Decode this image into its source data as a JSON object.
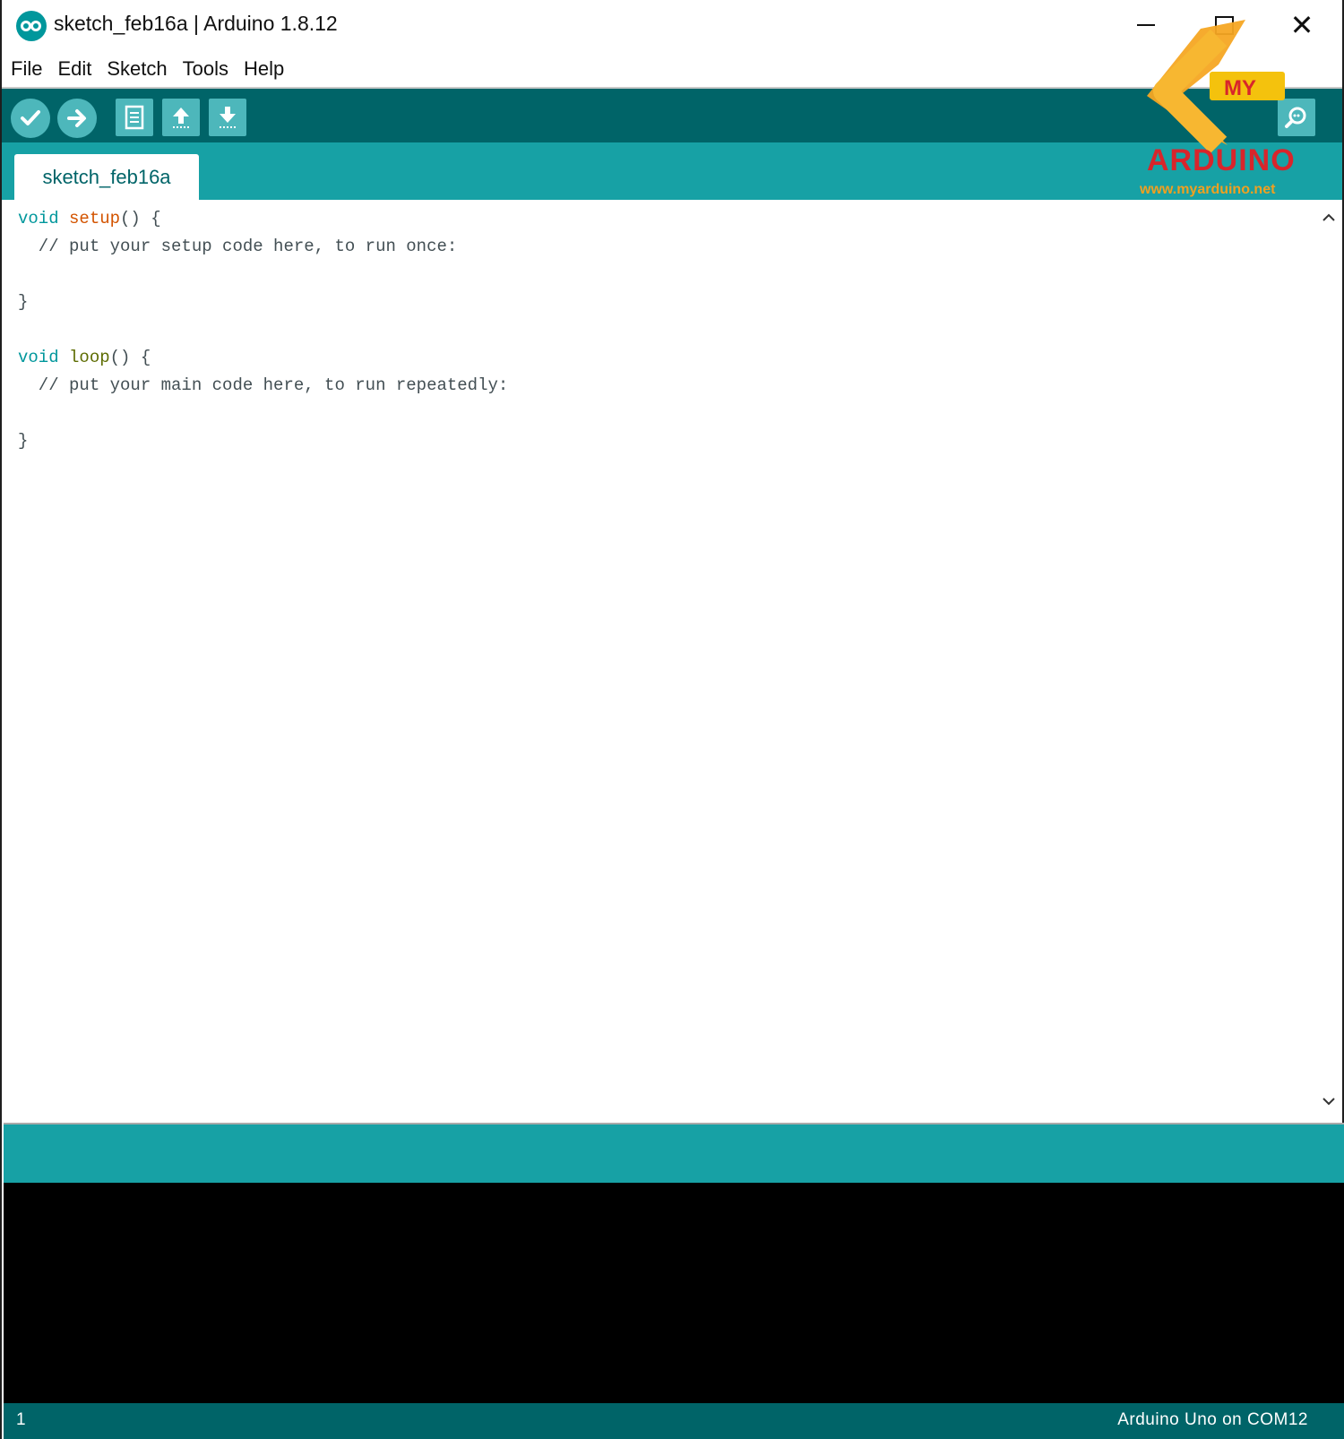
{
  "window": {
    "title": "sketch_feb16a | Arduino 1.8.12",
    "close_symbol": "✕"
  },
  "menu": [
    "File",
    "Edit",
    "Sketch",
    "Tools",
    "Help"
  ],
  "toolbar": {
    "buttons": [
      "verify-icon",
      "upload-icon",
      "new-icon",
      "open-icon",
      "save-icon",
      "serial-monitor-icon"
    ]
  },
  "tabs": [
    {
      "label": "sketch_feb16a",
      "active": true
    }
  ],
  "logo": {
    "top_text": "MY",
    "text": "ARDUINO",
    "url": "www.myarduino.net"
  },
  "editor": {
    "lines": [
      [
        "void",
        " ",
        "setup",
        "() {"
      ],
      [
        "",
        "  // put your setup code here, to run once:",
        "",
        ""
      ],
      [
        "",
        "",
        "",
        ""
      ],
      [
        "",
        "}",
        "",
        ""
      ],
      [
        "",
        "",
        "",
        ""
      ],
      [
        "void",
        " ",
        "loop",
        "() {"
      ],
      [
        "",
        "  // put your main code here, to run repeatedly:",
        "",
        ""
      ],
      [
        "",
        "",
        "",
        ""
      ],
      [
        "",
        "}",
        "",
        ""
      ]
    ]
  },
  "status": {
    "line_number": "1",
    "board": "Arduino Uno on COM12"
  },
  "colors": {
    "toolbar_bg": "#006468",
    "tab_bar_bg": "#17a1a5",
    "keyword": "#00979c",
    "function_setup": "#d35400",
    "function_loop": "#5e6d03"
  }
}
